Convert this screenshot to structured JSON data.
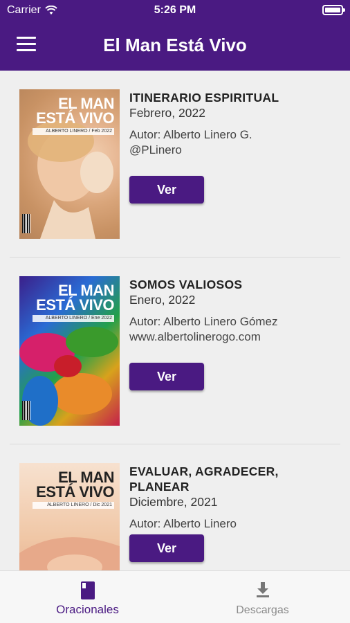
{
  "status_bar": {
    "carrier": "Carrier",
    "time": "5:26 PM"
  },
  "nav": {
    "title": "El Man Está Vivo"
  },
  "items": [
    {
      "name": "ITINERARIO ESPIRITUAL",
      "date": "Febrero, 2022",
      "author_line1": "Autor: Alberto Linero G.",
      "author_line2": "@PLinero",
      "button": "Ver",
      "cover_title_1": "EL MAN",
      "cover_title_2": "ESTÁ VIVO",
      "cover_sub": "ALBERTO LINERO / Feb 2022"
    },
    {
      "name": "SOMOS VALIOSOS",
      "date": "Enero, 2022",
      "author_line1": "Autor: Alberto Linero Gómez",
      "author_line2": "www.albertolinerogo.com",
      "button": "Ver",
      "cover_title_1": "EL MAN",
      "cover_title_2": "ESTÁ VIVO",
      "cover_sub": "ALBERTO LINERO / Ene 2022"
    },
    {
      "name": "EVALUAR, AGRADECER, PLANEAR",
      "date": "Diciembre, 2021",
      "author_line1": "Autor: Alberto Linero",
      "author_line2": "",
      "button": "Ver",
      "cover_title_1": "EL MAN",
      "cover_title_2": "ESTÁ VIVO",
      "cover_sub": "ALBERTO LINERO / Dic 2021"
    }
  ],
  "tabs": [
    {
      "label": "Oracionales",
      "icon": "book-icon",
      "active": true
    },
    {
      "label": "Descargas",
      "icon": "download-icon",
      "active": false
    }
  ],
  "colors": {
    "primary": "#4a1a82",
    "background": "#efefef",
    "inactive_tab": "#8a8a8a"
  }
}
